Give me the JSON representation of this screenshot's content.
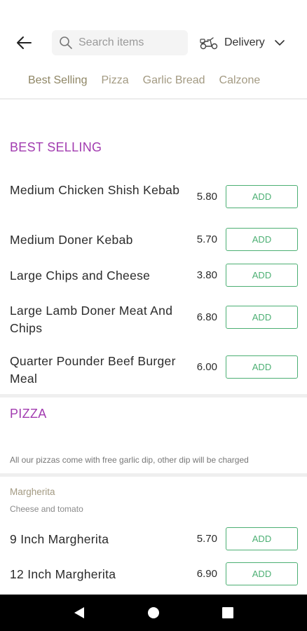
{
  "header": {
    "search_placeholder": "Search items",
    "delivery_label": "Delivery"
  },
  "tabs": [
    {
      "label": "Best Selling",
      "active": true
    },
    {
      "label": "Pizza",
      "active": false
    },
    {
      "label": "Garlic Bread",
      "active": false
    },
    {
      "label": "Calzone",
      "active": false
    }
  ],
  "best_selling": {
    "title": "BEST SELLING",
    "items": [
      {
        "name": "Medium Chicken Shish Kebab",
        "price": "5.80",
        "add_label": "ADD"
      },
      {
        "name": "Medium Doner Kebab",
        "price": "5.70",
        "add_label": "ADD"
      },
      {
        "name": "Large Chips and Cheese",
        "price": "3.80",
        "add_label": "ADD"
      },
      {
        "name": "Large Lamb Doner Meat And Chips",
        "price": "6.80",
        "add_label": "ADD"
      },
      {
        "name": "Quarter Pounder Beef Burger Meal",
        "price": "6.00",
        "add_label": "ADD"
      }
    ]
  },
  "pizza": {
    "title": "PIZZA",
    "note": "All our pizzas come with free garlic dip, other dip will be charged",
    "group": {
      "name": "Margherita",
      "description": "Cheese and tomato"
    },
    "items": [
      {
        "name": "9 Inch Margherita",
        "price": "5.70",
        "add_label": "ADD"
      },
      {
        "name": "12 Inch Margherita",
        "price": "6.90",
        "add_label": "ADD"
      }
    ]
  },
  "colors": {
    "accent_green": "#4caf73",
    "section_purple": "#a23cb0",
    "tab_text": "#a39a82"
  }
}
